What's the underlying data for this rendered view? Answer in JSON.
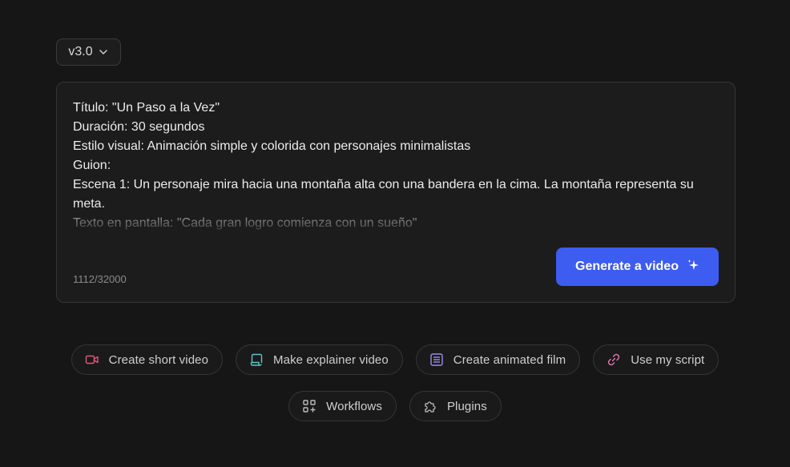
{
  "version_select": {
    "label": "v3.0",
    "icon": "chevron-down-icon"
  },
  "prompt": {
    "lines": [
      "Título: \"Un Paso a la Vez\"",
      "Duración: 30 segundos",
      "Estilo visual: Animación simple y colorida con personajes minimalistas",
      "Guion:",
      "Escena 1: Un personaje mira hacia una montaña alta con una bandera en la cima. La montaña representa su meta.",
      "Texto en pantalla: \"Cada gran logro comienza con un sueño\""
    ],
    "char_count": "1112/32000"
  },
  "generate_button": {
    "label": "Generate a video",
    "icon": "sparkle-icon",
    "color": "#3d5cf0"
  },
  "suggestions": {
    "row1": [
      {
        "label": "Create short video",
        "icon": "video-camera-icon",
        "icon_color": "#e0567a"
      },
      {
        "label": "Make explainer video",
        "icon": "scroll-icon",
        "icon_color": "#5ec4c9"
      },
      {
        "label": "Create animated film",
        "icon": "list-document-icon",
        "icon_color": "#9a8cf0"
      },
      {
        "label": "Use my script",
        "icon": "link-icon",
        "icon_color": "#e07ab0"
      }
    ],
    "row2": [
      {
        "label": "Workflows",
        "icon": "grid-plus-icon",
        "icon_color": "#bdbdbd"
      },
      {
        "label": "Plugins",
        "icon": "puzzle-icon",
        "icon_color": "#bdbdbd"
      }
    ]
  },
  "colors": {
    "background": "#161616",
    "card": "#1c1c1c",
    "accent": "#3d5cf0"
  }
}
